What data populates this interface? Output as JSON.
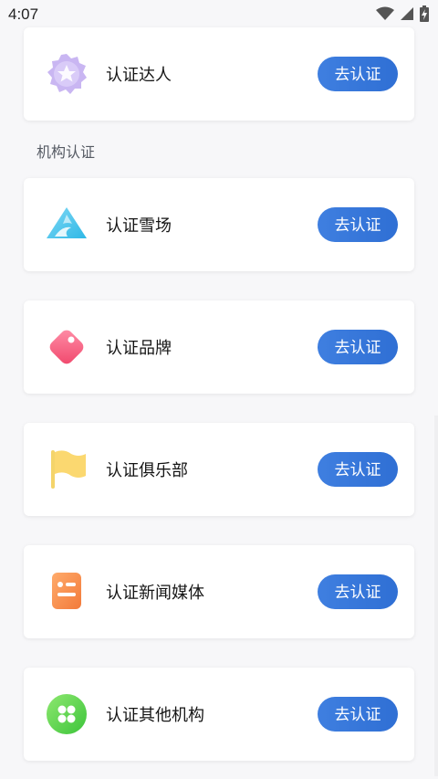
{
  "status_bar": {
    "time": "4:07",
    "icons": [
      "wifi-icon",
      "signal-icon",
      "battery-icon"
    ]
  },
  "top_card": {
    "label": "认证达人",
    "button": "去认证",
    "icon": "star-badge-icon"
  },
  "section": {
    "title": "机构认证"
  },
  "org_cards": [
    {
      "label": "认证雪场",
      "button": "去认证",
      "icon": "ski-slope-icon"
    },
    {
      "label": "认证品牌",
      "button": "去认证",
      "icon": "tag-icon"
    },
    {
      "label": "认证俱乐部",
      "button": "去认证",
      "icon": "flag-icon"
    },
    {
      "label": "认证新闻媒体",
      "button": "去认证",
      "icon": "news-icon"
    },
    {
      "label": "认证其他机构",
      "button": "去认证",
      "icon": "clover-icon"
    }
  ],
  "colors": {
    "button": "#3574db",
    "background": "#f7f7f9",
    "card": "#ffffff"
  }
}
